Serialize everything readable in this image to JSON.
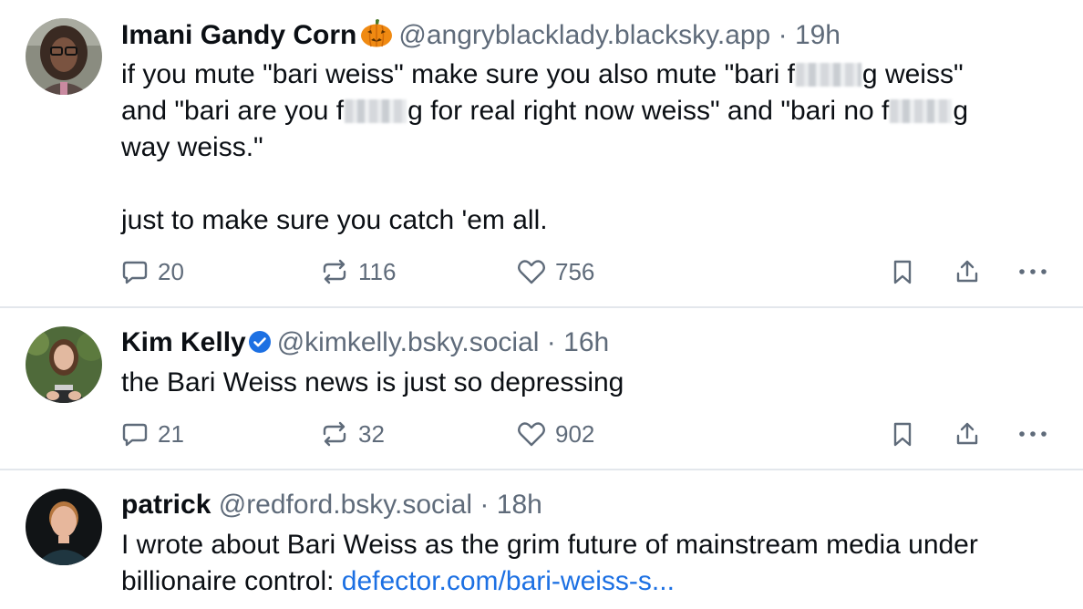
{
  "colors": {
    "text": "#0b0f14",
    "muted": "#5f6b7a",
    "link": "#1c70e3",
    "verified": "#1c70e3",
    "divider": "#e3e7ec"
  },
  "posts": [
    {
      "name": "Imani Gandy Corn",
      "name_emoji": "pumpkin-emoji",
      "handle": "@angryblacklady.blacksky.app",
      "separator": "·",
      "time": "19h",
      "text": {
        "l1a": "if you mute \"bari weiss\" make sure you also mute \"bari f",
        "l1b": "g weiss\"",
        "l2a": "and \"bari are you f",
        "l2b": "g for real right now weiss\" and \"bari no f",
        "l2c": "g",
        "l3": "way weiss.\"",
        "l4": "just to make sure you catch 'em all."
      },
      "counts": {
        "replies": "20",
        "reposts": "116",
        "likes": "756"
      }
    },
    {
      "name": "Kim Kelly",
      "verified": true,
      "handle": "@kimkelly.bsky.social",
      "separator": "·",
      "time": "16h",
      "text": {
        "l1": "the Bari Weiss news is just so depressing"
      },
      "counts": {
        "replies": "21",
        "reposts": "32",
        "likes": "902"
      }
    },
    {
      "name": "patrick",
      "handle": "@redford.bsky.social",
      "separator": "·",
      "time": "18h",
      "text": {
        "l1": "I wrote about Bari Weiss as the grim future of mainstream media under",
        "l2": "billionaire control: ",
        "link": "defector.com/bari-weiss-s..."
      }
    }
  ]
}
